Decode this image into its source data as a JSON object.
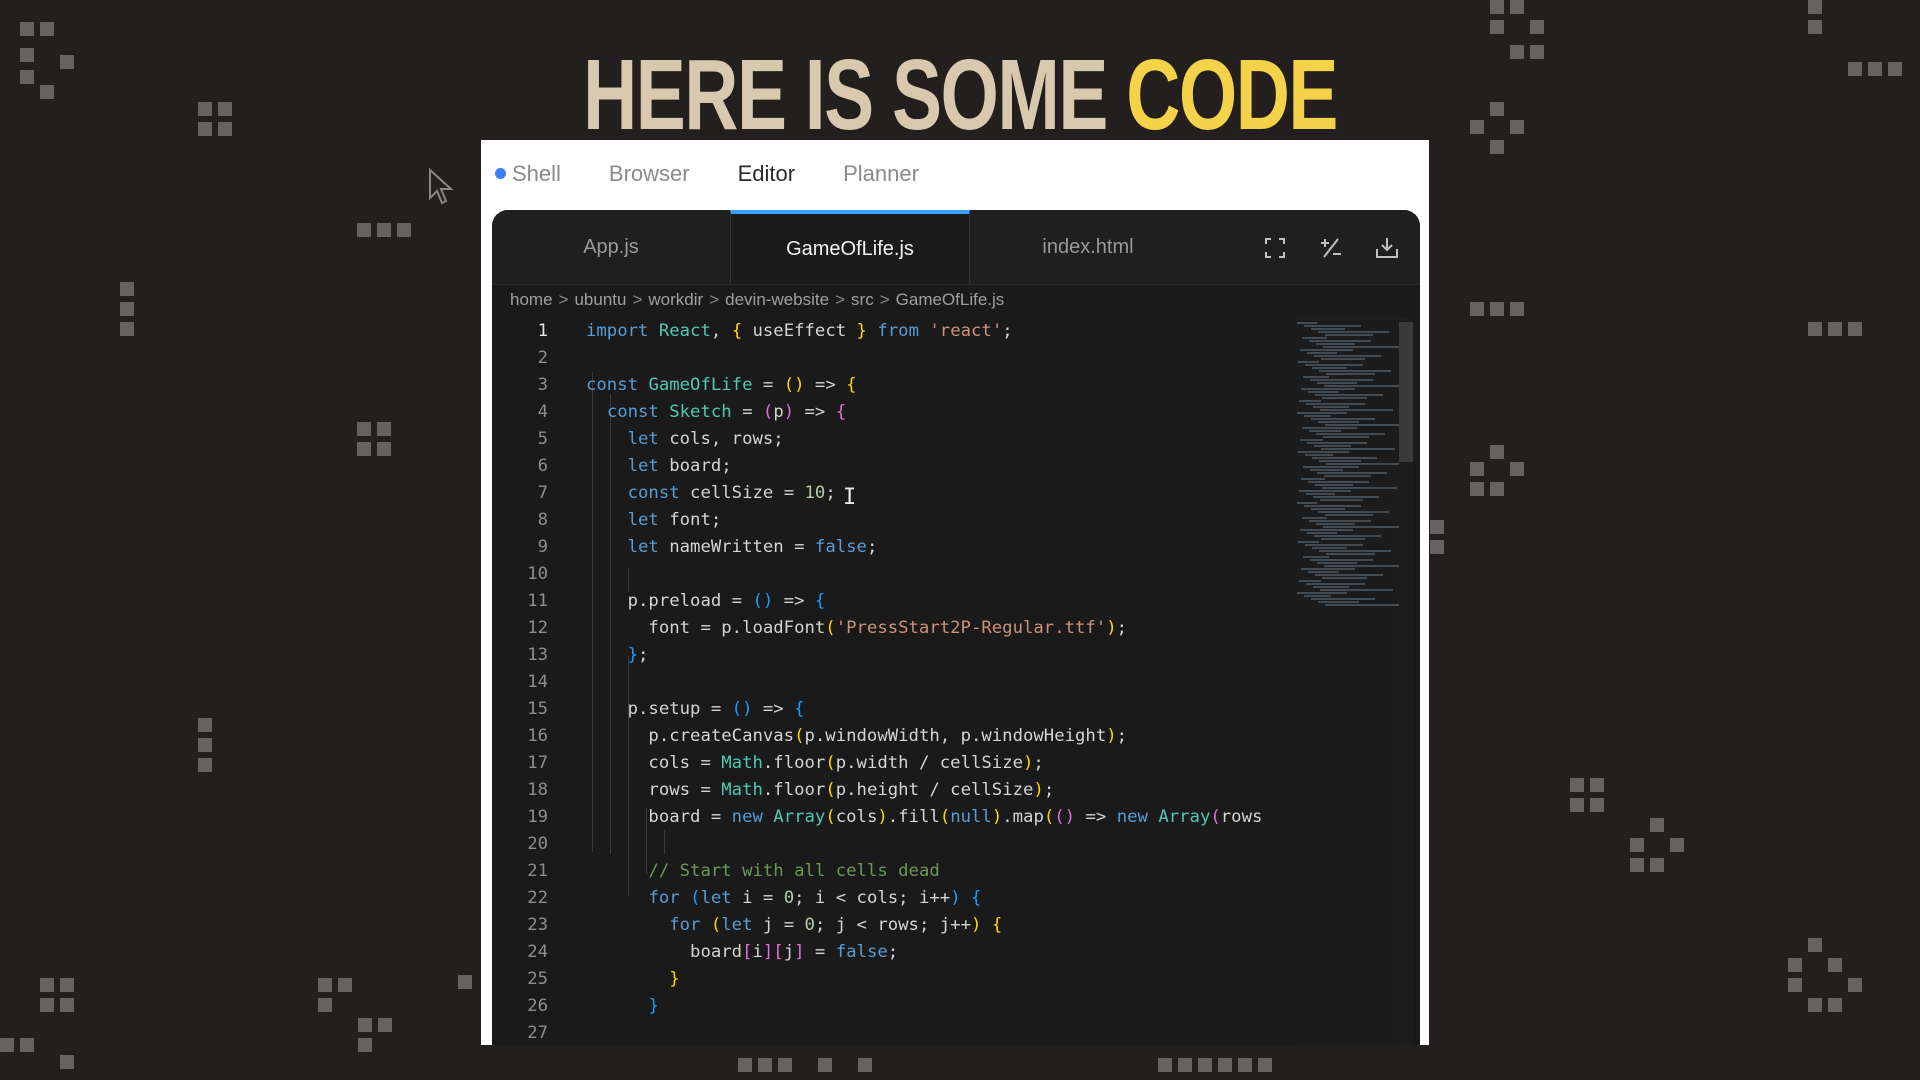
{
  "headline": {
    "part1": "HERE IS SOME",
    "part2": "CODE",
    "colors": {
      "part1": "#d8c9ae",
      "part2": "#f4d24a"
    }
  },
  "top_tabs": [
    {
      "label": "Shell",
      "indicator": "blue-dot",
      "active": false
    },
    {
      "label": "Browser",
      "active": false
    },
    {
      "label": "Editor",
      "active": true
    },
    {
      "label": "Planner",
      "active": false
    }
  ],
  "file_tabs": [
    {
      "label": "App.js",
      "active": false
    },
    {
      "label": "GameOfLife.js",
      "active": true
    },
    {
      "label": "index.html",
      "active": false
    }
  ],
  "toolbar_icons": [
    "fullscreen-icon",
    "plus-minus-icon",
    "download-icon"
  ],
  "breadcrumb": [
    "home",
    "ubuntu",
    "workdir",
    "devin-website",
    "src",
    "GameOfLife.js"
  ],
  "breadcrumb_separator": ">",
  "current_line": 1,
  "code_lines": [
    "import React, { useEffect } from 'react';",
    "",
    "const GameOfLife = () => {",
    "  const Sketch = (p) => {",
    "    let cols, rows;",
    "    let board;",
    "    const cellSize = 10;",
    "    let font;",
    "    let nameWritten = false;",
    "",
    "    p.preload = () => {",
    "      font = p.loadFont('PressStart2P-Regular.ttf');",
    "    };",
    "",
    "    p.setup = () => {",
    "      p.createCanvas(p.windowWidth, p.windowHeight);",
    "      cols = Math.floor(p.width / cellSize);",
    "      rows = Math.floor(p.height / cellSize);",
    "      board = new Array(cols).fill(null).map(() => new Array(rows",
    "",
    "      // Start with all cells dead",
    "      for (let i = 0; i < cols; i++) {",
    "        for (let j = 0; j < rows; j++) {",
    "          board[i][j] = false;",
    "        }",
    "      }",
    ""
  ],
  "theme": {
    "accent": "#3aa0ff",
    "editor_bg": "#1a1a1a",
    "page_bg": "#231f1e"
  }
}
